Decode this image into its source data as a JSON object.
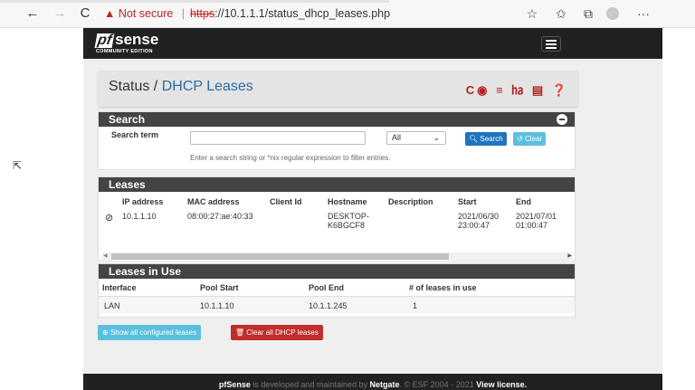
{
  "browser": {
    "back": "←",
    "forward": "→",
    "reload": "C",
    "warning_icon": "▲",
    "not_secure": "Not secure",
    "separator": "|",
    "url_scheme": "https",
    "url_rest": "://10.1.1.1/status_dhcp_leases.php",
    "icons": [
      "reader-mode-icon",
      "favorites-icon",
      "collections-icon",
      "profile-icon",
      "more-icon"
    ],
    "more": "···"
  },
  "navbar": {
    "logo_pf": "pf",
    "logo_sense": "sense",
    "logo_sub": "COMMUNITY EDITION"
  },
  "title": {
    "prefix": "Status /",
    "current": "DHCP Leases",
    "icons": "C◉ ≡ ㏊ ▤ ❓"
  },
  "search": {
    "header": "Search",
    "term_label": "Search term",
    "term_value": "",
    "select_value": "All",
    "search_button": "Search",
    "clear_button": "Clear",
    "help": "Enter a search string or *nix regular expression to filter entries."
  },
  "leases": {
    "header": "Leases",
    "columns": [
      "IP address",
      "MAC address",
      "Client Id",
      "Hostname",
      "Description",
      "Start",
      "End"
    ],
    "rows": [
      {
        "status_icon": "⊘",
        "ip": "10.1.1.10",
        "mac": "08:00:27:ae:40:33",
        "client_id": "",
        "hostname_1": "DESKTOP-",
        "hostname_2": "K6BGCF8",
        "description": "",
        "start_date": "2021/06/30",
        "start_time": "23:00:47",
        "end_date": "2021/07/01",
        "end_time": "01:00:47"
      }
    ]
  },
  "in_use": {
    "header": "Leases in Use",
    "columns": [
      "Interface",
      "Pool Start",
      "Pool End",
      "# of leases in use"
    ],
    "rows": [
      {
        "interface": "LAN",
        "pool_start": "10.1.1.10",
        "pool_end": "10.1.1.245",
        "count": "1"
      }
    ]
  },
  "actions": {
    "show_all": "Show all configured leases",
    "clear_all": "Clear all DHCP leases"
  },
  "footer": {
    "pre": "pfSense",
    "mid": " is developed and maintained by ",
    "company": "Netgate",
    "copy": ". © ESF 2004 - 2021 ",
    "license": "View license."
  }
}
